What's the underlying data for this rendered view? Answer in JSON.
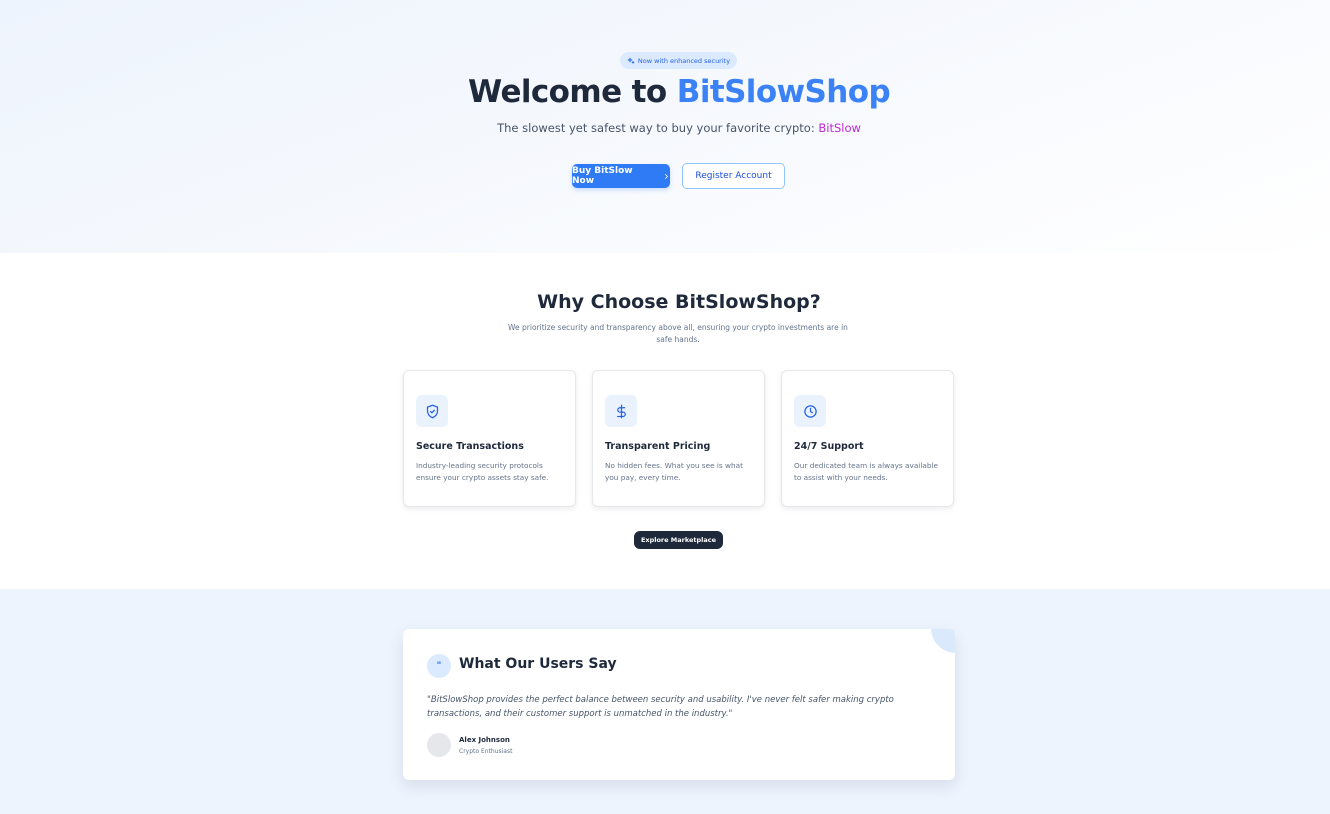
{
  "hero": {
    "badge": "Now with enhanced security",
    "title_prefix": "Welcome to ",
    "title_brand": "BitSlowShop",
    "subtitle_prefix": "The slowest yet safest way to buy your favorite crypto: ",
    "subtitle_brand": "BitSlow",
    "primary_button": "Buy BitSlow Now",
    "secondary_button": "Register Account"
  },
  "why": {
    "title": "Why Choose BitSlowShop?",
    "subtitle": "We prioritize security and transparency above all, ensuring your crypto investments are in safe hands.",
    "features": [
      {
        "icon": "shield-icon",
        "title": "Secure Transactions",
        "description": "Industry-leading security protocols ensure your crypto assets stay safe."
      },
      {
        "icon": "dollar-icon",
        "title": "Transparent Pricing",
        "description": "No hidden fees. What you see is what you pay, every time."
      },
      {
        "icon": "clock-icon",
        "title": "24/7 Support",
        "description": "Our dedicated team is always available to assist with your needs."
      }
    ],
    "explore_button": "Explore Marketplace"
  },
  "testimonial": {
    "quote_mark": "\"",
    "title": "What Our Users Say",
    "quote": "\"BitSlowShop provides the perfect balance between security and usability. I've never felt safer making crypto transactions, and their customer support is unmatched in the industry.\"",
    "name": "Alex Johnson",
    "role": "Crypto Enthusiast"
  },
  "colors": {
    "accent": "#3b82f6",
    "brand_purple": "#c026d3",
    "dark": "#1e293b",
    "testimonial_bg": "#edf4fe"
  }
}
